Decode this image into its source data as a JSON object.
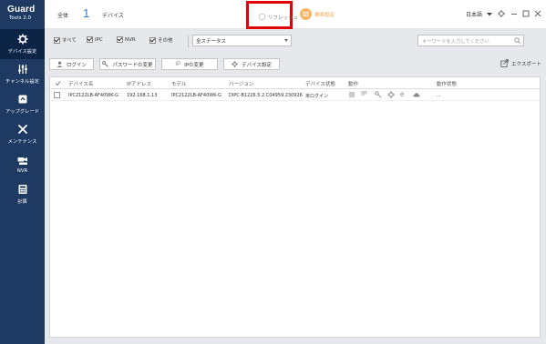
{
  "app": {
    "logo_line1": "Guard",
    "logo_line2": "Tools 2.0"
  },
  "sidebar": {
    "items": [
      {
        "label": "デバイス設定",
        "icon": "gear-icon"
      },
      {
        "label": "チャンネル設定",
        "icon": "sliders-icon"
      },
      {
        "label": "アップグレード",
        "icon": "upgrade-icon"
      },
      {
        "label": "メンテナンス",
        "icon": "wrench-icon"
      },
      {
        "label": "NVR",
        "icon": "nvr-icon"
      },
      {
        "label": "計算",
        "icon": "calculator-icon"
      }
    ]
  },
  "topbar": {
    "all_label": "全体",
    "device_count": "1",
    "device_label": "デバイス",
    "refresh_label": "リフレッシュ",
    "search_settings_label": "検索設定",
    "language": "日本語",
    "highlight_color": "#e30000"
  },
  "filters": {
    "checkboxes": [
      {
        "label": "すべて",
        "checked": true
      },
      {
        "label": "IPC",
        "checked": true
      },
      {
        "label": "NVR",
        "checked": true
      },
      {
        "label": "その他",
        "checked": true
      }
    ],
    "status_select": "全ステータス",
    "keyword_placeholder": "キーワードを入力してください"
  },
  "actions": {
    "login": "ログイン",
    "change_password": "パスワードの変更",
    "change_ip": "IPの変更",
    "device_settings": "デバイス設定",
    "export": "エクスポート"
  },
  "table": {
    "headers": [
      "デバイス名",
      "IPアドレス",
      "モデル",
      "バージョン",
      "デバイス状態",
      "動作",
      "動作状態"
    ],
    "rows": [
      {
        "name": "IPC2122LB-AF40WK-G",
        "ip": "192.168.1.13",
        "model": "IPC2122LB-AF40WK-G",
        "version": "DIPC-B1226.5.2.C04959.230926",
        "status": "未ログイン",
        "op_status": "..."
      }
    ]
  }
}
